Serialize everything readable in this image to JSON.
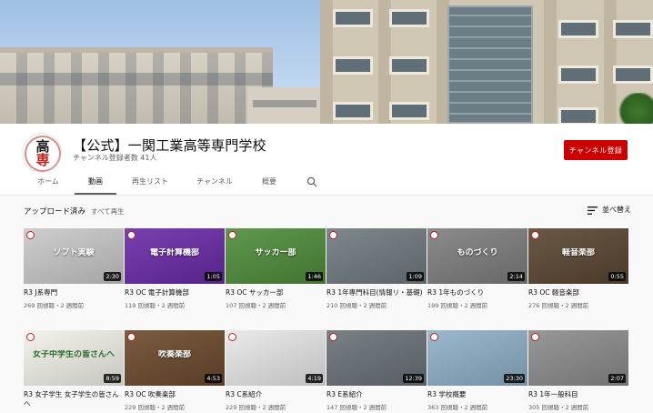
{
  "channel": {
    "name": "【公式】一関工業高等専門学校",
    "subscribers": "チャンネル登録者数 41人",
    "subscribe_label": "チャンネル登録",
    "avatar_text_top": "高",
    "avatar_text_bottom": "専"
  },
  "tabs": [
    {
      "label": "ホーム"
    },
    {
      "label": "動画"
    },
    {
      "label": "再生リスト"
    },
    {
      "label": "チャンネル"
    },
    {
      "label": "概要"
    }
  ],
  "active_tab": "動画",
  "section": {
    "title": "アップロード済み",
    "play_all": "すべて再生",
    "sort_label": "並べ替え"
  },
  "videos": [
    {
      "thumb_text": "ソフト実験",
      "duration": "2:30",
      "title": "R3 J系専門",
      "views": "269 回視聴・2 週間前",
      "bg": "#c9c9c9",
      "fg": "#ffffff"
    },
    {
      "thumb_text": "電子計算機部",
      "duration": "1:05",
      "title": "R3 OC 電子計算機部",
      "views": "119 回視聴・2 週間前",
      "bg": "#6a2aa8",
      "fg": "#ffffff"
    },
    {
      "thumb_text": "サッカー部",
      "duration": "1:46",
      "title": "R3 OC サッカー部",
      "views": "107 回視聴・2 週間前",
      "bg": "#4e8d3a",
      "fg": "#ffffff"
    },
    {
      "thumb_text": "",
      "duration": "1:09",
      "title": "R3 1年専門科目(情報リ・基礎)",
      "views": "210 回視聴・2 週間前",
      "bg": "#707a80",
      "fg": "#ffffff"
    },
    {
      "thumb_text": "ものづくり",
      "duration": "2:14",
      "title": "R3 1年ものづくり",
      "views": "199 回視聴・2 週間前",
      "bg": "#7e7e7e",
      "fg": "#ffffff"
    },
    {
      "thumb_text": "軽音楽部",
      "duration": "0:55",
      "title": "R3 OC 軽音楽部",
      "views": "276 回視聴・2 週間前",
      "bg": "#5a4632",
      "fg": "#ffffff"
    },
    {
      "thumb_text": "女子中学生の皆さんへ",
      "duration": "8:59",
      "title": "R3 女子学生 女子学生の皆さんへ",
      "views": "",
      "bg": "#f2f2ea",
      "fg": "#2d6a2d"
    },
    {
      "thumb_text": "吹奏楽部",
      "duration": "4:53",
      "title": "R3 OC 吹奏楽部",
      "views": "229 回視聴・2 週間前",
      "bg": "#6b4a2c",
      "fg": "#ffffff"
    },
    {
      "thumb_text": "",
      "duration": "4:19",
      "title": "R3 C系紹介",
      "views": "229 回視聴・2 週間前",
      "bg": "#e8e8e8",
      "fg": "#333333"
    },
    {
      "thumb_text": "",
      "duration": "12:39",
      "title": "R3 E系紹介",
      "views": "147 回視聴・2 週間前",
      "bg": "#6a7278",
      "fg": "#ffffff"
    },
    {
      "thumb_text": "",
      "duration": "23:30",
      "title": "R3 学校概要",
      "views": "363 回視聴・2 週間前",
      "bg": "#8fb0c8",
      "fg": "#ffffff"
    },
    {
      "thumb_text": "",
      "duration": "2:07",
      "title": "R3 1年一般科目",
      "views": "305 回視聴・2 週間前",
      "bg": "#8c8c8c",
      "fg": "#ffffff"
    }
  ],
  "colors": {
    "accent": "#cc0000",
    "text": "#0f0f0f",
    "secondary_text": "#606060"
  },
  "icons": {
    "search": "search-icon",
    "sort": "sort-icon"
  }
}
